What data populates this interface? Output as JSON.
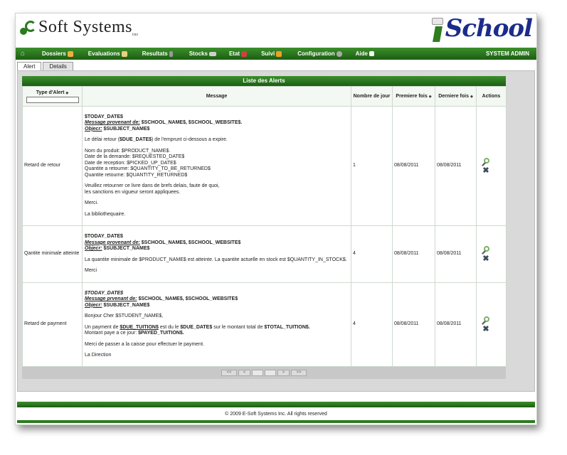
{
  "header": {
    "logo_text": "Soft Systems",
    "logo_inc": "inc",
    "brand_text": "School"
  },
  "nav": {
    "items": [
      "Dossiers",
      "Evaluations",
      "Resultats",
      "Stocks",
      "Etat",
      "Suivi",
      "Configuration",
      "Aide"
    ],
    "user": "SYSTEM ADMIN"
  },
  "tabs": [
    "Alert",
    "Details"
  ],
  "table": {
    "caption": "Liste des Alerts",
    "headers": {
      "type": "Type d'Alert",
      "message": "Message",
      "count": "Nombre de jour",
      "first": "Premiere fois",
      "last": "Derniere fois",
      "actions": "Actions"
    },
    "sort_glyph": "◆",
    "rows": [
      {
        "type": "Retard de retour",
        "msg": {
          "date": "$TODAY_DATE$",
          "from_label": "Message provenant de:",
          "from_value": " $SCHOOL_NAME$, $SCHOOL_WEBSITE$.",
          "obj_label": "Objecr:",
          "obj_value": " $SUBJECT_NAME$",
          "p1_a": "Le délai retour (",
          "p1_b": "$DUE_DATE$",
          "p1_c": ") de l'emprunt ci-dessous a expire.",
          "p2_l1": "Nom du produit: $PRODUCT_NAME$.",
          "p2_l2": "Date de la demande: $REQUESTED_DATE$",
          "p2_l3": "Date de reception: $PICKED_UP_DATE$",
          "p2_l4": "Quantite a retourne: $QUANTITY_TO_BE_RETURNED$",
          "p2_l5": "Quantite retourne: $QUANTITY_RETURNED$",
          "p3_l1": "Veuillez retourner ce livre dans de brefs delais, faute de quoi,",
          "p3_l2": "les sanctions en vigueur seront appliquees.",
          "p4": "Merci.",
          "p5": "La bibliothequaire."
        },
        "count": "1",
        "first": "08/08/2011",
        "last": "08/08/2011"
      },
      {
        "type": "Qantite minimale atteinte",
        "msg": {
          "date": "$TODAY_DATE$",
          "from_label": "Message provenant de:",
          "from_value": " $SCHOOL_NAME$, $SCHOOL_WEBSITE$",
          "obj_label": "Objecr:",
          "obj_value": " $SUBJECT_NAME$",
          "p1": "La quantite minimale de $PRODUCT_NAME$ est atteinte. La quantite actuelle en stock est $QUANTITY_IN_STOCK$.",
          "p2": "Merci"
        },
        "count": "4",
        "first": "08/08/2011",
        "last": "08/08/2011"
      },
      {
        "type": "Retard de payment",
        "msg": {
          "date": "$TODAY_DATE$",
          "from_label": "Message prvenant de:",
          "from_value": " $SCHOOL_NAME$, $SCHOOL_WEBSITE$",
          "obj_label": "Objecr:",
          "obj_value": " $SUBJECT_NAME$",
          "p1": "Bonjour Cher $STUDENT_NAME$,",
          "p2_a": "Un payment de ",
          "p2_b": "$DUE_TUITION$",
          "p2_c": " est du le ",
          "p2_d": "$DUE_DATE$",
          "p2_e": " sur le montant total de ",
          "p2_f": "$TOTAL_TUITION$.",
          "p2_g": "Montant paye a ce jour: ",
          "p2_h": "$PAYED_TUITION$.",
          "p3": "Merci de passer a la caisse pour effectuer le payment.",
          "p4": "La Direction"
        },
        "count": "4",
        "first": "08/08/2011",
        "last": "08/08/2011"
      }
    ]
  },
  "pager": {
    "first": "<<",
    "prev": "<",
    "next": ">",
    "last": ">>"
  },
  "footer": {
    "copyright": "© 2009 E-Soft Systems Inc. All rights reserved"
  },
  "icons": {
    "home": "home-icon",
    "view": "magnifier-icon",
    "delete": "delete-x-icon"
  },
  "colors": {
    "nav_green": "#2d7a20",
    "brand_blue": "#1b2c8a"
  }
}
